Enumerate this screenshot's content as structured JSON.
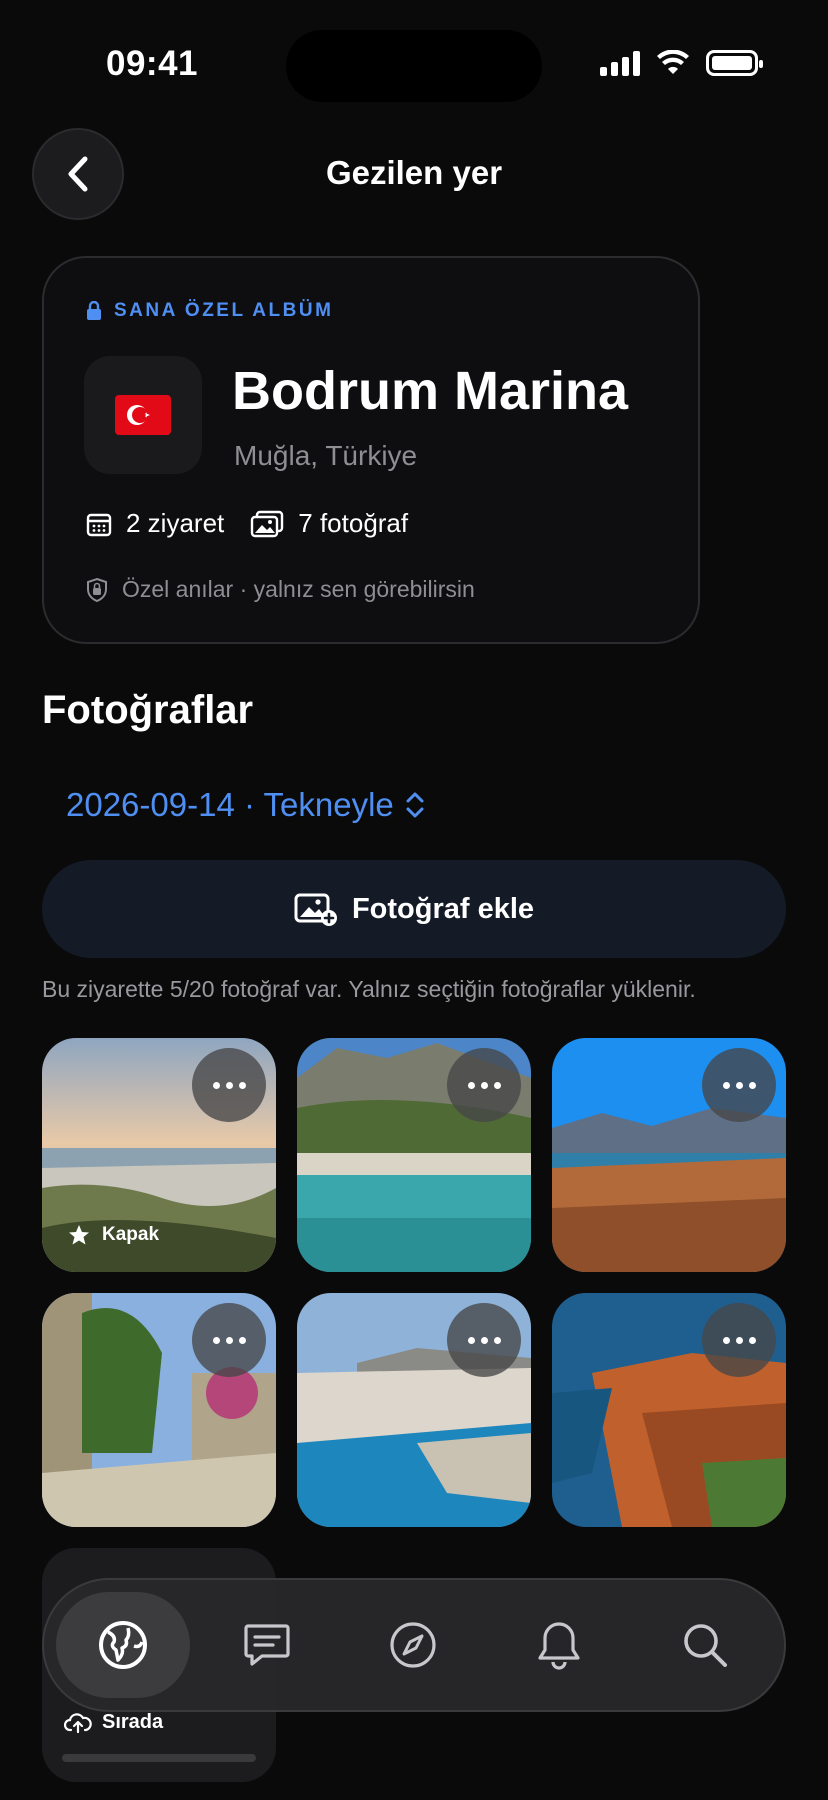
{
  "status_bar": {
    "time": "09:41"
  },
  "header": {
    "title": "Gezilen yer"
  },
  "place": {
    "private_label": "SANA ÖZEL ALBÜM",
    "flag": "🇹🇷",
    "name": "Bodrum Marina",
    "location": "Muğla, Türkiye",
    "visits": "2 ziyaret",
    "photos": "7 fotoğraf",
    "privacy_note": "Özel anılar · yalnız sen görebilirsin"
  },
  "photos_section": {
    "title": "Fotoğraflar",
    "visit_selector": "2026-09-14 · Tekneyle",
    "add_button": "Fotoğraf ekle",
    "hint": "Bu ziyarette 5/20 fotoğraf var. Yalnız seçtiğin fotoğraflar yüklenir.",
    "cover_label": "Kapak",
    "pending_label": "Sırada"
  },
  "tabbar": {
    "items": [
      {
        "icon": "globe-icon",
        "active": true
      },
      {
        "icon": "chat-icon",
        "active": false
      },
      {
        "icon": "compass-icon",
        "active": false
      },
      {
        "icon": "bell-icon",
        "active": false
      },
      {
        "icon": "search-icon",
        "active": false
      }
    ]
  },
  "colors": {
    "accent": "#4f8ff2",
    "background": "#0a0a0b"
  }
}
